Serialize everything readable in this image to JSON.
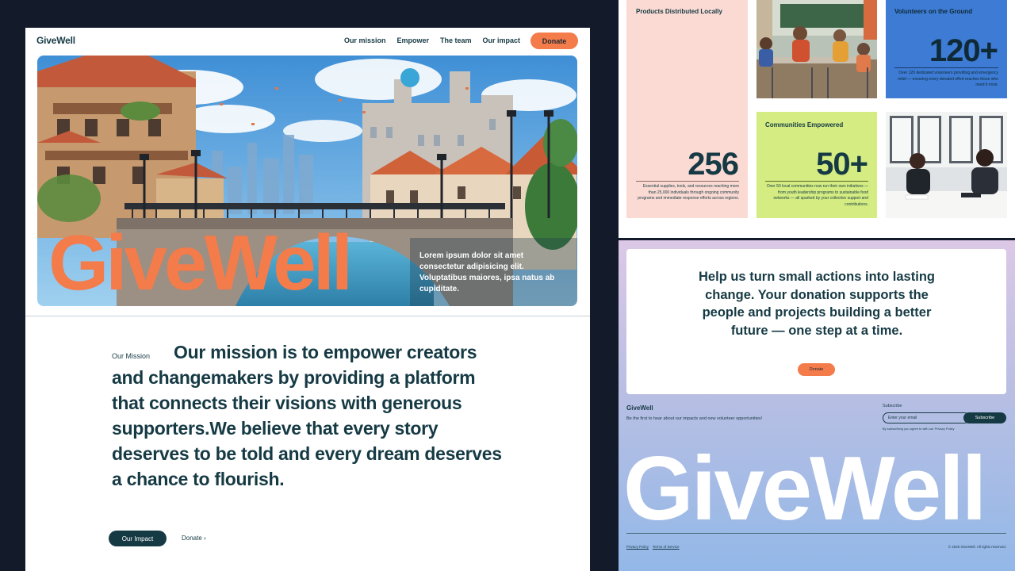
{
  "brand": "GiveWell",
  "nav": {
    "links": [
      "Our mission",
      "Empower",
      "The team",
      "Our impact"
    ],
    "donate": "Donate"
  },
  "hero": {
    "wordmark": "GiveWell",
    "text": "Lorem ipsum dolor sit amet consectetur adipisicing elit. Voluptatibus maiores, ipsa natus ab cupiditate."
  },
  "mission": {
    "label": "Our Mission",
    "text": "Our mission is to empower creators and changemakers by providing a platform that connects their visions with generous supporters.We believe that every story deserves to be told and every dream deserves a chance to flourish.",
    "primary_button": "Our Impact",
    "secondary_link": "Donate"
  },
  "stats": [
    {
      "title": "Products Distributed Locally",
      "value": "256",
      "description": "Essential supplies, tools, and resources reaching more than 25,000 individuals through ongoing community programs and immediate response efforts across regions.",
      "color": "#fbdad3"
    },
    {
      "title": "Volunteers on the Ground",
      "value": "120+",
      "description": "Over 120 dedicated volunteers providing and emergency relief — ensuring every donated effort reaches those who need it most.",
      "color": "#3d7bd4"
    },
    {
      "title": "Communities Empowered",
      "value": "50+",
      "description": "Over 50 local communities now run their own initiatives — from youth leadership programs to sustainable food networks — all sparked by your collective support and contributions.",
      "color": "#d4ec82"
    }
  ],
  "cta": {
    "text": "Help us turn small actions into lasting change. Your donation supports the people and projects building a better future — one step at a time.",
    "button": "Donate"
  },
  "footer": {
    "logo": "GiveWell",
    "tagline": "Be the first to hear about our impacts and new volunteer opportunities!",
    "subscribe_label": "Subscribe",
    "email_placeholder": "Enter your email",
    "subscribe_button": "Subscribe",
    "subscribe_note": "By subscribing you agree to with our Privacy Policy",
    "big_wordmark": "GiveWell",
    "links": [
      "Privacy Policy",
      "Terms of Service"
    ],
    "copyright": "© 2025 GiveWell. All rights reserved."
  },
  "colors": {
    "accent": "#f47b4a",
    "dark": "#163a44",
    "page_bg": "#131a2a"
  }
}
